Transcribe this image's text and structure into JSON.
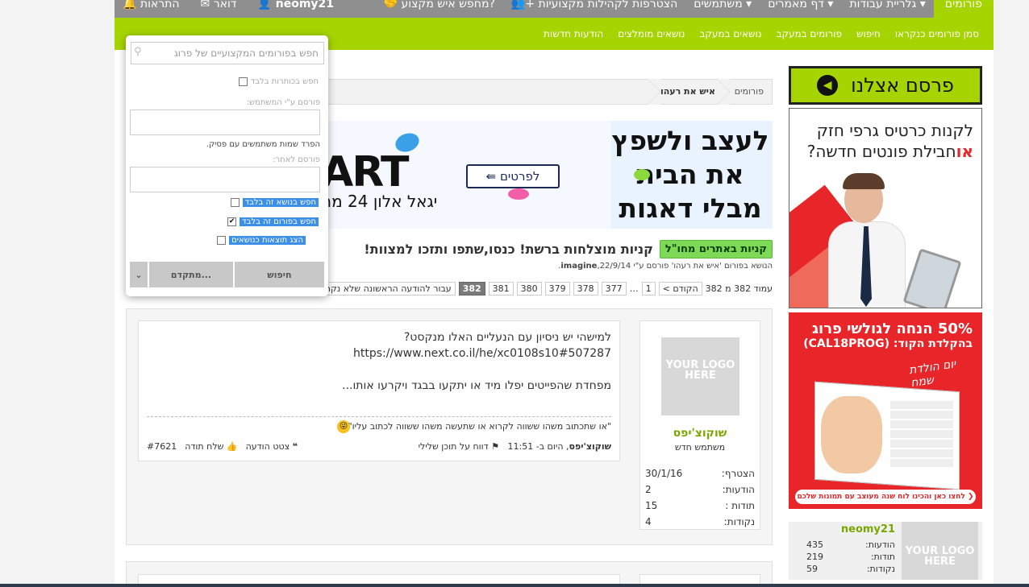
{
  "topbar": {
    "tabs": [
      "פורומים",
      "גלריית עבודות ▾",
      "דף מאמרים ▾",
      "משתמשים ▾",
      "הצטרפות לקהילות מקצועיות",
      "מחפש איש מקצוע?"
    ],
    "user": "neomy21",
    "mail": "דואר",
    "alerts": "התראות"
  },
  "subnav": {
    "links": [
      "סמן פורומים כנקראו",
      "חיפוש",
      "פורומים במעקב",
      "נושאים במעקב",
      "נושאים מומלצים",
      "הודעות חדשות"
    ]
  },
  "search": {
    "placeholder": "חפש בפורומים המקצועיים של פרוג",
    "titles_only": "חפש בכותרות בלבד",
    "posted_by_label": "פורסם ע\"י המשתמש:",
    "separate_hint": "הפרד שמות משתמשים עם פסיק.",
    "newer_than_label": "פורסם לאחר:",
    "this_thread": "חפש בנושא זה בלבד",
    "this_forum": "חפש בפורום זה בלבד",
    "show_as_threads": "הצג תוצאות כנושאים",
    "search_btn": "חיפוש",
    "advanced_btn": "מתקדם..."
  },
  "breadcrumb": {
    "root": "פורומים",
    "current": "איש את רעהו"
  },
  "banner": {
    "heading": "לעצב ולשפץ את הבית מבלי דאגות",
    "logo": "לפרטים",
    "brand": "ART",
    "sub": "יגאל אלון 24 מח"
  },
  "thread": {
    "badge": "קניות באתרים מחו\"ל",
    "title": "קניות מוצלחות ברשת! כנסו,שתפו ותזכו למצוות!",
    "meta_prefix": "הנושא בפורום 'איש את רעהו' פורסם ע\"י",
    "meta_user": "imagine",
    "meta_date": ",22/9/14."
  },
  "pager": {
    "label": "עמוד 382 מ 382",
    "prev": "< הקודם",
    "pages": [
      "1",
      "…",
      "377",
      "378",
      "379",
      "380",
      "381",
      "382"
    ],
    "current": "382",
    "first_unread": "עבור להודעה הראשונה שלא נקראה"
  },
  "post": {
    "line1": "למישהי יש ניסיון עם הנעליים האלו מנקסט?",
    "line2": "https://www.next.co.il/he/xc0108s10#507287",
    "line3": "מפחדת שהפייטים יפלו מיד או יתקעו בבגד ויקרעו אותו...",
    "signature": "\"או שתכתוב משהו ששווה לקרוא או שתעשה משהו ששווה לכתוב עליו\"",
    "author": "שוקוצ'יפס",
    "time": ", היום ב- 11:51",
    "report": "דווח על תוכן שלילי",
    "post_no": "#7621",
    "thanks": "שלח תודה",
    "quote": "צטט הודעה"
  },
  "author_card": {
    "avatar_text": "YOUR LOGO HERE",
    "name": "שוקוצ'יפס",
    "role": "משתמש חדש",
    "joined_label": "הצטרף:",
    "joined": "30/1/16",
    "posts_label": "הודעות:",
    "posts": "2",
    "thanks_label": "תודות :",
    "thanks": "15",
    "points_label": "נקודות:",
    "points": "4"
  },
  "sidebar": {
    "advert": "פרסם אצלנו",
    "ad1_line1": "לקנות כרטיס גרפי חזק",
    "ad1_or": "או",
    "ad1_line2": "חבילת פונטים חדשה?",
    "ad2_line1": "50% הנחה לגולשי פרוג",
    "ad2_line2": "בהקלדת הקוד: (CAL18PROG)",
    "ad2_script": "יום הולדת שמח",
    "ad2_cta": "לחצו כאן והכינו לוח שנה מעוצב עם תמונות שלכם",
    "user_name": "neomy21",
    "user_logo": "YOUR LOGO HERE",
    "posts_label": "הודעות:",
    "posts": "435",
    "thanks_label": "תודות:",
    "thanks": "219",
    "points_label": "נקודות:",
    "points": "59"
  },
  "colors": {
    "brand_green": "#a6d400",
    "top_gray": "#8f8f8f",
    "ad_red": "#e8262a",
    "username_green": "#7aa600"
  }
}
